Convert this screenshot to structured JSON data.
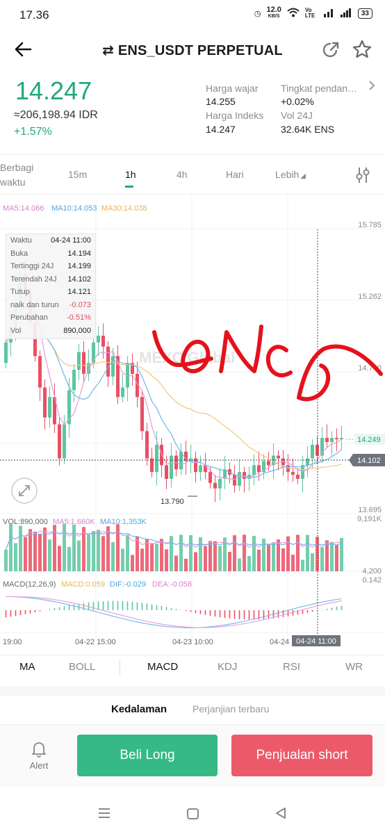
{
  "status": {
    "time": "17.36",
    "net_speed": "12.0",
    "net_unit": "KB/S",
    "volte": "Vo LTE",
    "battery": "33"
  },
  "header": {
    "title": "⇄ ENS_USDT PERPETUAL"
  },
  "ticker": {
    "price": "14.247",
    "idr": "≈206,198.94 IDR",
    "change": "+1.57%",
    "fair_label": "Harga wajar",
    "fair_value": "14.255",
    "index_label": "Harga Indeks",
    "index_value": "14.247",
    "funding_label": "Tingkat pendan…",
    "funding_value": "+0.02%",
    "vol_label": "Vol 24J",
    "vol_value": "32.64K ENS"
  },
  "tabs": {
    "share_line1": "Berbagi",
    "share_line2": "waktu",
    "m15": "15m",
    "h1": "1h",
    "h4": "4h",
    "day": "Hari",
    "more": "Lebih"
  },
  "chart": {
    "ma_legend": {
      "ma5": "MA5:14.066",
      "ma10": "MA10:14.053",
      "ma30": "MA30:14.038"
    },
    "price_axis": [
      "15.785",
      "15.262",
      "14.740",
      "13.695"
    ],
    "last_price_tag": "14.249",
    "cross_price_tag": "14.102",
    "low_label": "13.790",
    "watermark": "MEXC Global",
    "annotation": "LONG",
    "vol_legend": {
      "vol": "VOL:890,000",
      "ma5": "MA5:1,660K",
      "ma10": "MA10:1,353K"
    },
    "vol_axis": [
      "9,191K",
      "4,200"
    ],
    "macd_legend": {
      "name": "MACD(12,26,9)",
      "macd": "MACD:0.059",
      "dif": "DIF:-0.029",
      "dea": "DEA:-0.058"
    },
    "macd_axis": "0.142",
    "time_axis": [
      "19:00",
      "04-22 15:00",
      "04-23 10:00",
      "04-24"
    ],
    "cross_time": "04-24 11:00",
    "colors": {
      "up": "#5cc6a0",
      "down": "#ea4f63",
      "ma5": "#e79ad9",
      "ma10": "#6cb7e9",
      "ma30": "#f2c77a"
    }
  },
  "info": [
    {
      "label": "Waktu",
      "value": "04-24 11:00"
    },
    {
      "label": "Buka",
      "value": "14.194"
    },
    {
      "label": "Tertinggi 24J",
      "value": "14.199"
    },
    {
      "label": "Terendah 24J",
      "value": "14.102"
    },
    {
      "label": "Tutup",
      "value": "14.121"
    },
    {
      "label": "naik dan turun",
      "value": "-0.073"
    },
    {
      "label": "Perubahan",
      "value": "-0.51%"
    },
    {
      "label": "Vol",
      "value": "890,000"
    }
  ],
  "indicators": [
    "MA",
    "BOLL",
    "MACD",
    "KDJ",
    "RSI",
    "WR"
  ],
  "depth_tabs": {
    "depth": "Kedalaman",
    "trades": "Perjanjian terbaru"
  },
  "actions": {
    "alert": "Alert",
    "buy": "Beli Long",
    "sell": "Penjualan short"
  }
}
